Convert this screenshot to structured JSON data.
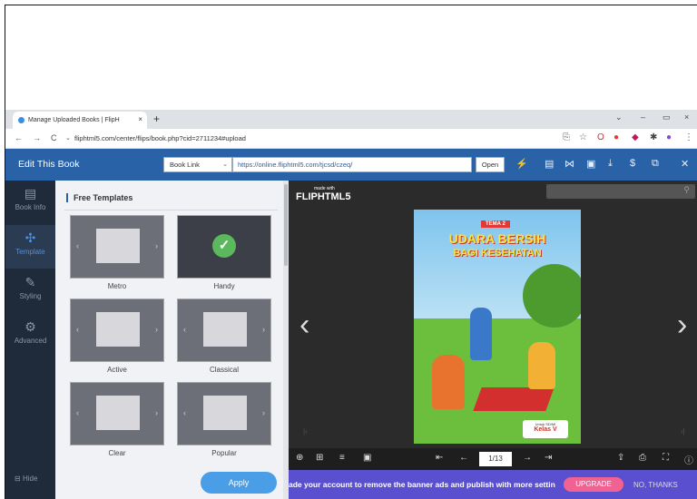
{
  "browser": {
    "tab_title": "Manage Uploaded Books | FlipH",
    "tab_close": "×",
    "new_tab": "+",
    "url": "fliphtml5.com/center/flips/book.php?cid=2711234#upload",
    "win_min": "–",
    "win_max": "▭",
    "win_close": "×"
  },
  "app": {
    "title": "Edit This Book",
    "link_select": "Book Link",
    "share_url": "https://online.fliphtml5.com/tjcsd/czeq/",
    "open_label": "Open"
  },
  "leftnav": {
    "items": [
      {
        "label": "Book Info"
      },
      {
        "label": "Template"
      },
      {
        "label": "Styling"
      },
      {
        "label": "Advanced"
      }
    ],
    "hide_label": "Hide"
  },
  "panel": {
    "heading": "Free Templates",
    "templates": [
      {
        "name": "Metro"
      },
      {
        "name": "Handy"
      },
      {
        "name": "Active"
      },
      {
        "name": "Classical"
      },
      {
        "name": "Clear"
      },
      {
        "name": "Popular"
      }
    ],
    "selected": "Handy",
    "apply_label": "Apply"
  },
  "viewer": {
    "logo_made": "made with",
    "logo_text": "FLIPHTML5",
    "cover": {
      "tema": "TEMA 2",
      "title_line1": "UDARA BERSIH",
      "title_line2": "BAGI KESEHATAN",
      "kelas_small": "Untuk SD/MI",
      "kelas": "Kelas V"
    },
    "page_indicator": "1/13"
  },
  "banner": {
    "message": "ade your account to remove the banner ads and publish with more settin",
    "upgrade": "UPGRADE",
    "no_thanks": "NO, THANKS"
  }
}
